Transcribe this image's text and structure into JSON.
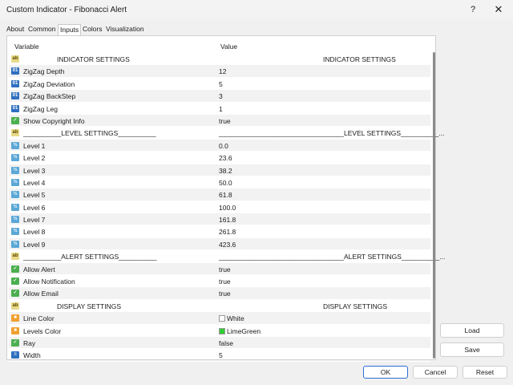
{
  "window": {
    "title": "Custom Indicator - Fibonacci Alert",
    "help_glyph": "?",
    "close_glyph": "✕"
  },
  "tabs": [
    {
      "label": "About",
      "active": false
    },
    {
      "label": "Common",
      "active": false
    },
    {
      "label": "Inputs",
      "active": true
    },
    {
      "label": "Colors",
      "active": false
    },
    {
      "label": "Visualization",
      "active": false
    }
  ],
  "grid": {
    "header_variable": "Variable",
    "header_value": "Value",
    "rows": [
      {
        "icon": "ab-icon",
        "type": "section",
        "variable": "INDICATOR SETTINGS",
        "value": "",
        "value2": "INDICATOR SETTINGS"
      },
      {
        "icon": "int-icon",
        "variable": "ZigZag Depth",
        "value": "12"
      },
      {
        "icon": "int-icon",
        "variable": "ZigZag Deviation",
        "value": "5"
      },
      {
        "icon": "int-icon",
        "variable": "ZigZag BackStep",
        "value": "3"
      },
      {
        "icon": "int-icon",
        "variable": "ZigZag Leg",
        "value": "1"
      },
      {
        "icon": "bool-icon",
        "variable": "Show Copyright Info",
        "value": "true"
      },
      {
        "icon": "ab-icon",
        "variable": "__________LEVEL SETTINGS__________",
        "value": "_________________________________LEVEL SETTINGS__________..."
      },
      {
        "icon": "double-icon",
        "variable": "Level 1",
        "value": "0.0"
      },
      {
        "icon": "double-icon",
        "variable": "Level 2",
        "value": "23.6"
      },
      {
        "icon": "double-icon",
        "variable": "Level 3",
        "value": "38.2"
      },
      {
        "icon": "double-icon",
        "variable": "Level 4",
        "value": "50.0"
      },
      {
        "icon": "double-icon",
        "variable": "Level 5",
        "value": "61.8"
      },
      {
        "icon": "double-icon",
        "variable": "Level 6",
        "value": "100.0"
      },
      {
        "icon": "double-icon",
        "variable": "Level 7",
        "value": "161.8"
      },
      {
        "icon": "double-icon",
        "variable": "Level 8",
        "value": "261.8"
      },
      {
        "icon": "double-icon",
        "variable": "Level 9",
        "value": "423.6"
      },
      {
        "icon": "ab-icon",
        "variable": "__________ALERT SETTINGS__________",
        "value": "_________________________________ALERT SETTINGS__________..."
      },
      {
        "icon": "bool-icon",
        "variable": "Allow Alert",
        "value": "true"
      },
      {
        "icon": "bool-icon",
        "variable": "Allow Notification",
        "value": "true"
      },
      {
        "icon": "bool-icon",
        "variable": "Allow Email",
        "value": "true"
      },
      {
        "icon": "ab-icon",
        "type": "section",
        "variable": "DISPLAY SETTINGS",
        "value": "",
        "value2": "DISPLAY SETTINGS"
      },
      {
        "icon": "color-icon",
        "variable": "Line Color",
        "value": "White",
        "swatch": "#ffffff"
      },
      {
        "icon": "color-icon",
        "variable": "Levels Color",
        "value": "LimeGreen",
        "swatch": "#32cd32"
      },
      {
        "icon": "bool-icon",
        "variable": "Ray",
        "value": "false"
      },
      {
        "icon": "width-icon",
        "variable": "Width",
        "value": "5"
      }
    ]
  },
  "buttons": {
    "load": "Load",
    "save": "Save",
    "ok": "OK",
    "cancel": "Cancel",
    "reset": "Reset"
  },
  "colors": {
    "accent": "#2a6fd3",
    "odd_row": "#f2f2f2"
  }
}
